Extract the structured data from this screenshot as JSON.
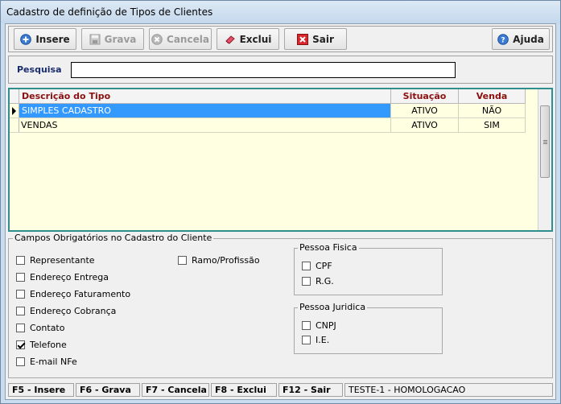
{
  "window": {
    "title": "Cadastro de definição de Tipos de Clientes"
  },
  "toolbar": {
    "insere": "Insere",
    "grava": "Grava",
    "cancela": "Cancela",
    "exclui": "Exclui",
    "sair": "Sair",
    "ajuda": "Ajuda"
  },
  "search": {
    "label": "Pesquisa",
    "value": ""
  },
  "grid": {
    "columns": [
      "Descrição do Tipo",
      "Situação",
      "Venda"
    ],
    "rows": [
      {
        "descricao": "SIMPLES CADASTRO",
        "situacao": "ATIVO",
        "venda": "NÃO"
      },
      {
        "descricao": "VENDAS",
        "situacao": "ATIVO",
        "venda": "SIM"
      }
    ]
  },
  "campos": {
    "title": "Campos Obrigatórios no Cadastro do Cliente",
    "items": [
      {
        "label": "Representante",
        "checked": false
      },
      {
        "label": "Endereço Entrega",
        "checked": false
      },
      {
        "label": "Endereço Faturamento",
        "checked": false
      },
      {
        "label": "Endereço Cobrança",
        "checked": false
      },
      {
        "label": "Contato",
        "checked": false
      },
      {
        "label": "Telefone",
        "checked": true
      },
      {
        "label": "E-mail NFe",
        "checked": false
      },
      {
        "label": "Ramo/Profissão",
        "checked": false
      }
    ]
  },
  "pessoa_fisica": {
    "title": "Pessoa Fisica",
    "items": [
      {
        "label": "CPF",
        "checked": false
      },
      {
        "label": "R.G.",
        "checked": false
      }
    ]
  },
  "pessoa_juridica": {
    "title": "Pessoa Juridica",
    "items": [
      {
        "label": "CNPJ",
        "checked": false
      },
      {
        "label": "I.E.",
        "checked": false
      }
    ]
  },
  "statusbar": {
    "f5": "F5 - Insere",
    "f6": "F6 - Grava",
    "f7": "F7 - Cancela",
    "f8": "F8 - Exclui",
    "f12": "F12 - Sair",
    "info": "TESTE-1 - HOMOLOGACAO"
  },
  "colors": {
    "selection": "#3399ff",
    "grid_bg": "#ffffe1",
    "header_text": "#8b1010",
    "search_label": "#1a2d6b"
  }
}
